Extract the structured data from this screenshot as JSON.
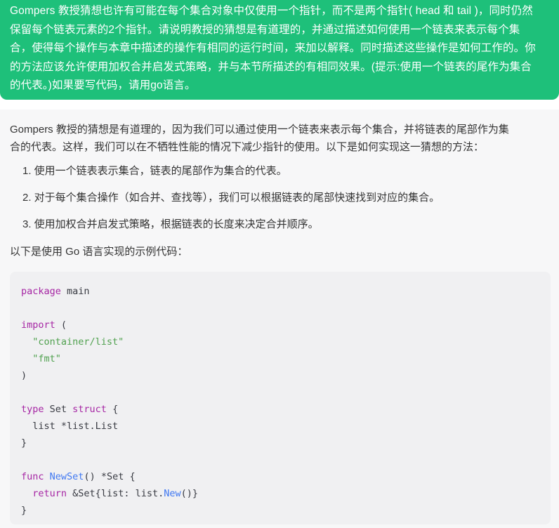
{
  "question": {
    "lines": [
      "Gompers 教授猜想也许有可能在每个集合对象中仅使用一个指针，而不是两个指针( head 和 tail )，同时仍然",
      "保留每个链表元素的2个指针。请说明教授的猜想是有道理的，并通过描述如何使用一个链表来表示每个集",
      "合，使得每个操作与本章中描述的操作有相同的运行时间，来加以解释。同时描述这些操作是如何工作的。你",
      "的方法应该允许使用加权合并启发式策略，并与本节所描述的有相同效果。(提示:使用一个链表的尾作为集合",
      "的代表。)如果要写代码，请用go语言。"
    ]
  },
  "answer": {
    "intro_lines": [
      "Gompers 教授的猜想是有道理的，因为我们可以通过使用一个链表来表示每个集合，并将链表的尾部作为集",
      "合的代表。这样，我们可以在不牺牲性能的情况下减少指针的使用。以下是如何实现这一猜想的方法："
    ],
    "steps": [
      "1. 使用一个链表表示集合，链表的尾部作为集合的代表。",
      "2. 对于每个集合操作（如合并、查找等），我们可以根据链表的尾部快速找到对应的集合。",
      "3. 使用加权合并启发式策略，根据链表的长度来决定合并顺序。"
    ],
    "code_lead": "以下是使用 Go 语言实现的示例代码：",
    "code": {
      "line1_kw": "package",
      "line1_rest": " main",
      "line3_kw": "import",
      "line3_rest": " (",
      "line4_str": "\"container/list\"",
      "line5_str": "\"fmt\"",
      "line6": ")",
      "line8_kw1": "type",
      "line8_mid": " Set ",
      "line8_kw2": "struct",
      "line8_rest": " {",
      "line9_a": "  list ",
      "line9_b": "*list.List",
      "line10": "}",
      "line12_kw": "func",
      "line12_fn": "NewSet",
      "line12_rest": "() *Set {",
      "line13_kw": "return",
      "line13_mid": " &Set{list: list.",
      "line13_fn": "New",
      "line13_rest": "()}",
      "line14": "}"
    }
  }
}
